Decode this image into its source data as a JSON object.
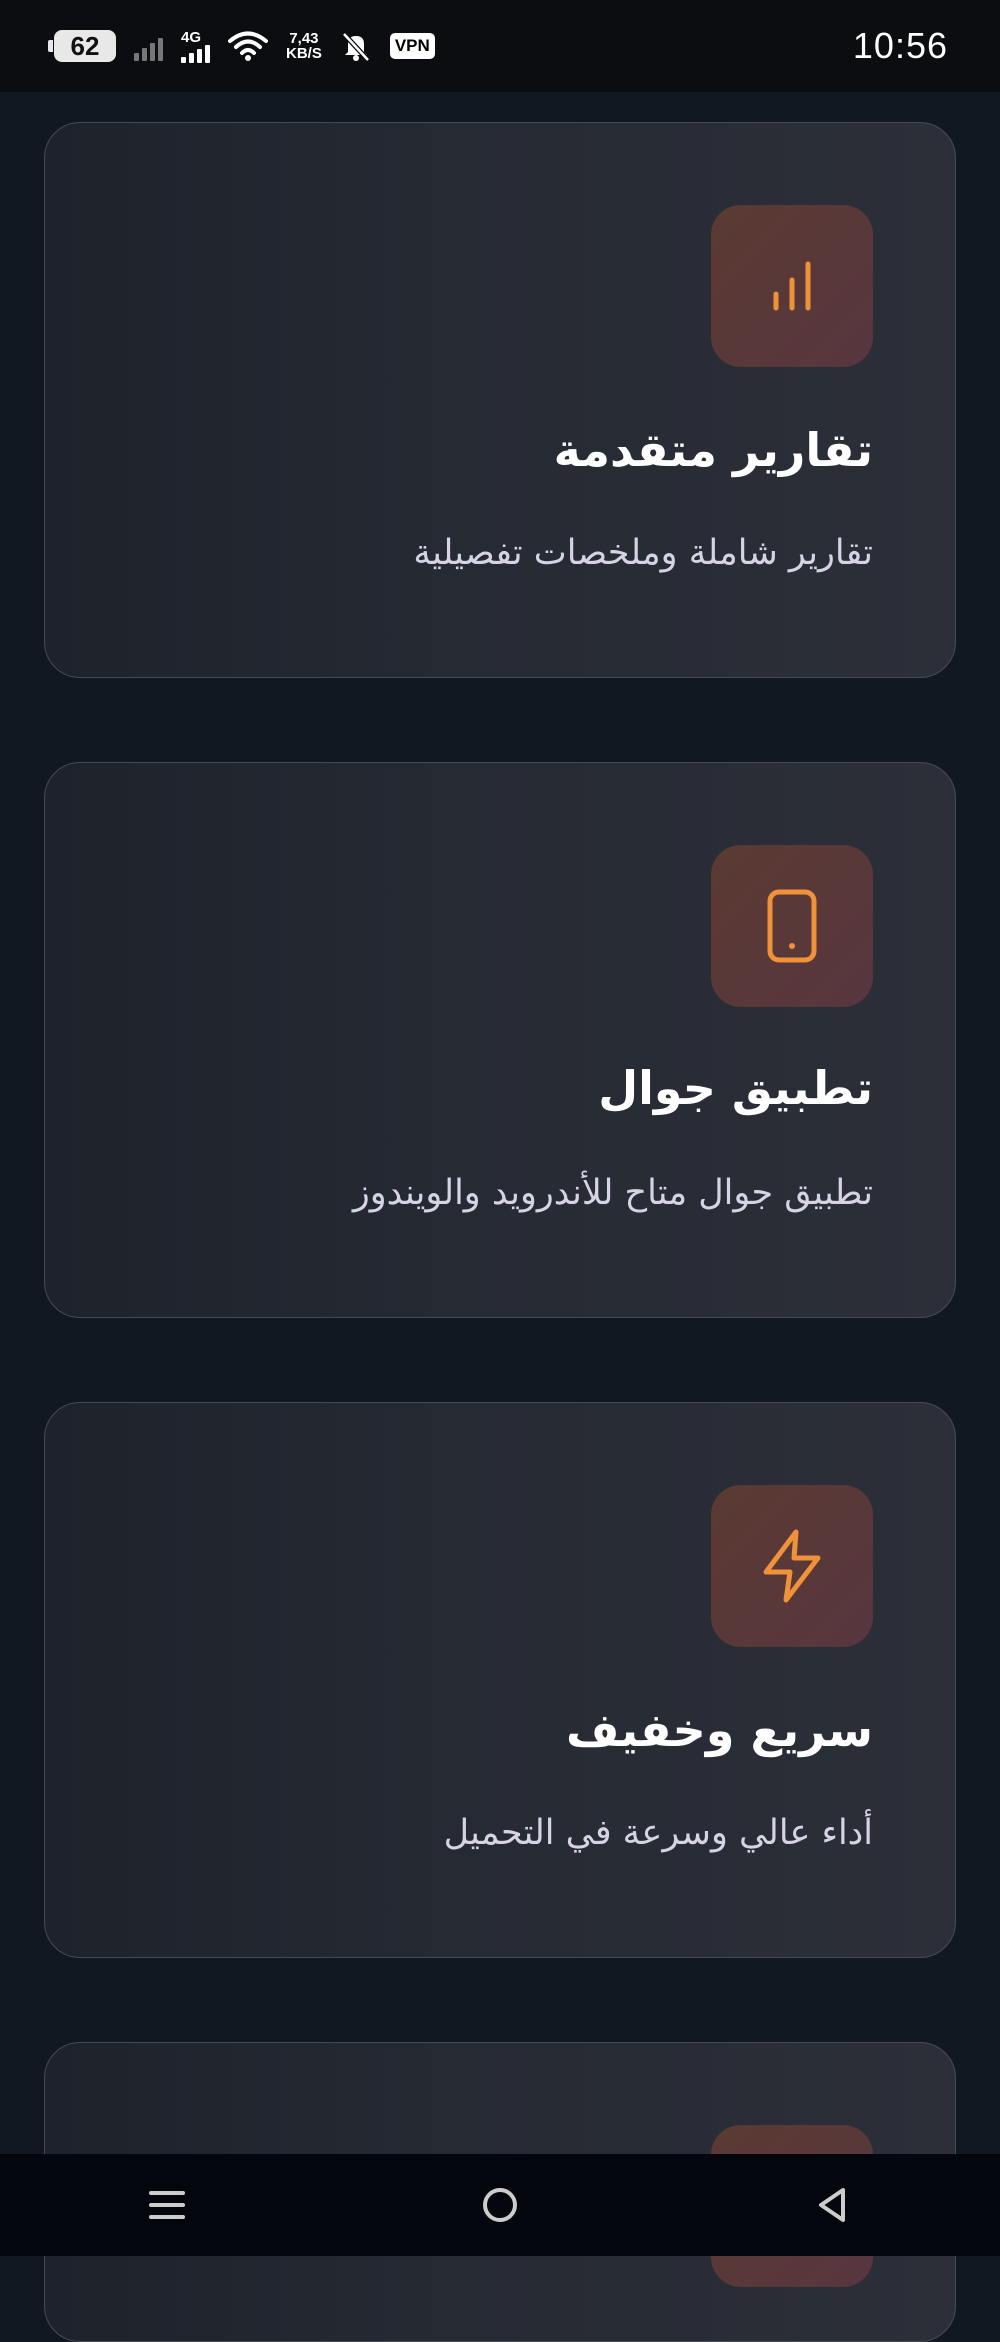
{
  "status_bar": {
    "battery": "62",
    "network": "4G",
    "speed_value": "7,43",
    "speed_unit": "KB/S",
    "vpn": "VPN",
    "time": "10:56"
  },
  "features": [
    {
      "icon": "bar-chart-icon",
      "title": "تقارير متقدمة",
      "description": "تقارير شاملة وملخصات تفصيلية"
    },
    {
      "icon": "smartphone-icon",
      "title": "تطبيق جوال",
      "description": "تطبيق جوال متاح للأندرويد والويندوز"
    },
    {
      "icon": "lightning-icon",
      "title": "سريع وخفيف",
      "description": "أداء عالي وسرعة في التحميل"
    }
  ],
  "colors": {
    "background": "#121821",
    "accent": "#f0923a",
    "icon_box": "#583a3a",
    "title": "#ffffff",
    "description": "#d7d3e6"
  },
  "nav_bar": {
    "menu": "menu-icon",
    "home": "home-icon",
    "back": "back-icon"
  }
}
